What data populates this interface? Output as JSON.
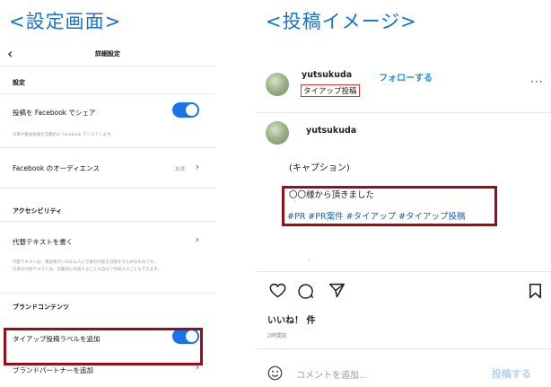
{
  "headings": {
    "left": "<設定画面>",
    "right": "<投稿イメージ>"
  },
  "settings": {
    "title": "詳細設定",
    "section_settings": "設定",
    "facebook_share": "投稿を Facebook でシェア",
    "facebook_share_desc": "写真や動画投稿を自動的に Facebook でシェアします。",
    "facebook_audience": "Facebook のオーディエンス",
    "facebook_audience_value": "友達",
    "section_accessibility": "アクセシビリティ",
    "alt_text": "代替テキストを書く",
    "alt_text_desc_1": "代替テキストは、視覚障がいのある人に写真の内容を説明するためのものです。",
    "alt_text_desc_2": "写真の代替テキストは、自動的に作成することも自分で作成することもできます。",
    "section_brand": "ブランドコンテンツ",
    "tieup_label": "タイアップ投稿ラベルを追加",
    "brand_partner": "ブランドパートナーを追加"
  },
  "post": {
    "username": "yutsukuda",
    "follow": "フォローする",
    "tieup_tag": "タイアップ投稿",
    "more": "···",
    "comment_username": "yutsukuda",
    "caption": "(キャプション)",
    "thanks": "〇〇様から頂きました",
    "hashtags": "#PR #PR案件 #タイアップ #タイアップ投稿",
    "likes": "いいね！ 件",
    "time": "2時間前",
    "comment_placeholder": "コメントを追加...",
    "post_button": "投稿する"
  },
  "colors": {
    "accent": "#1a73e8",
    "highlight": "#9b0d17",
    "heading": "#1673d6"
  }
}
